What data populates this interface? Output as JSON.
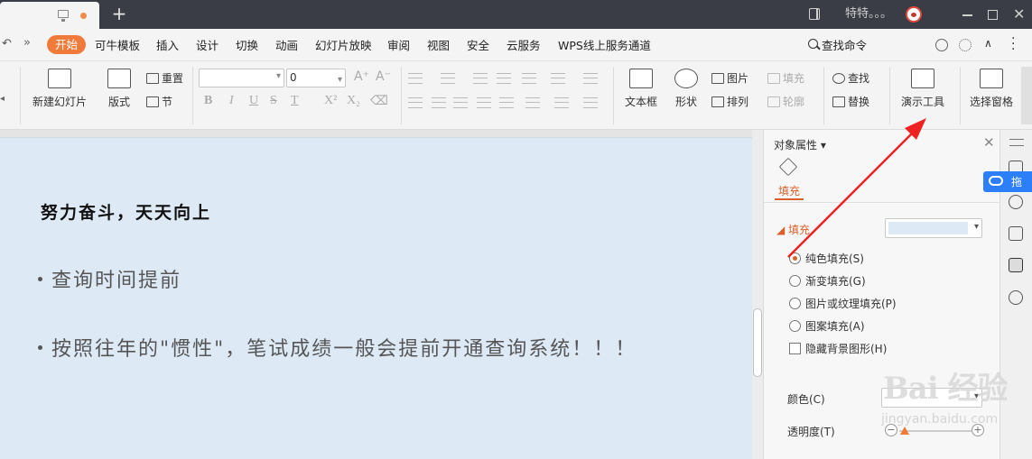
{
  "titlebar": {
    "user_name": "特特。。。",
    "close_glyph": "✕",
    "new_tab_glyph": "+"
  },
  "menu": {
    "undo_glyph": "↶",
    "more_glyph": "»",
    "start": "开始",
    "items": [
      "可牛模板",
      "插入",
      "设计",
      "切换",
      "动画",
      "幻灯片放映",
      "审阅",
      "视图",
      "安全",
      "云服务",
      "WPS线上服务通道"
    ],
    "search_label": "查找命令"
  },
  "ribbon": {
    "new_slide": "新建幻灯片",
    "layout": "版式",
    "reset": "重置",
    "section": "节",
    "font_size": "0",
    "text_box": "文本框",
    "shape": "形状",
    "picture": "图片",
    "arrange": "排列",
    "fill": "填充",
    "outline": "轮廓",
    "find": "查找",
    "replace": "替换",
    "presentation_tools": "演示工具",
    "selection_pane": "选择窗格"
  },
  "slide": {
    "title": "努力奋斗，天天向上",
    "bullets": [
      "查询时间提前",
      "按照往年的\"惯性\"，笔试成绩一般会提前开通查询系统！！！"
    ]
  },
  "panel": {
    "title": "对象属性",
    "tab_fill": "填充",
    "section_fill": "填充",
    "options": {
      "solid": "纯色填充(S)",
      "gradient": "渐变填充(G)",
      "picture": "图片或纹理填充(P)",
      "pattern": "图案填充(A)",
      "hide_bg": "隐藏背景图形(H)"
    },
    "color_label": "颜色(C)",
    "transparency_label": "透明度(T)",
    "fill_color": "#dde9f5"
  },
  "side": {
    "baidu_label": "拖"
  },
  "watermark": {
    "brand": "Bai 经验",
    "url": "jingyan.baidu.com"
  },
  "colors": {
    "accent": "#f07a3a",
    "panel_accent": "#d9602c",
    "arrow": "#ee2222"
  }
}
